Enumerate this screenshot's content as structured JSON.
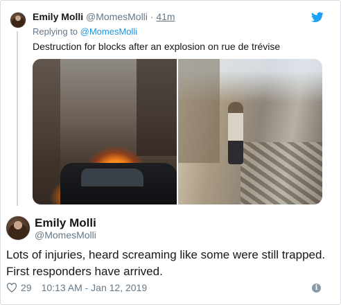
{
  "tweet1": {
    "name": "Emily Molli",
    "handle": "@MomesMolli",
    "dot": "·",
    "time": "41m",
    "replying_prefix": "Replying to ",
    "replying_handle": "@MomesMolli",
    "text": "Destruction for blocks after an explosion on rue de trévise",
    "media": [
      {
        "icon": "photo-fire-street"
      },
      {
        "icon": "photo-debris-person"
      }
    ]
  },
  "tweet2": {
    "name": "Emily Molli",
    "handle": "@MomesMolli",
    "text_line1": "Lots of injuries, heard screaming like some were still trapped.",
    "text_line2": "First responders have arrived.",
    "likes": "29",
    "timestamp": "10:13 AM - Jan 12, 2019"
  },
  "colors": {
    "link": "#1b95e0",
    "muted": "#657786",
    "like_icon": "#657786",
    "twitter_blue": "#1da1f2"
  },
  "icons": {
    "bird": "twitter-bird-icon",
    "heart": "heart-icon",
    "info": "info-icon"
  }
}
